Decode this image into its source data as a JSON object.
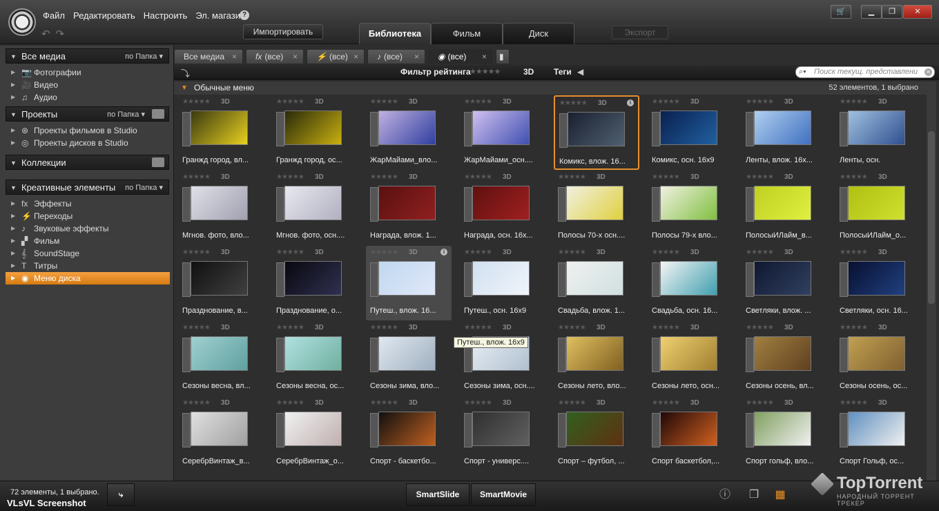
{
  "menu": [
    "Файл",
    "Редактировать",
    "Настроить",
    "Эл. магазин"
  ],
  "help_glyph": "?",
  "import_label": "Импортировать",
  "main_tabs": [
    "Библиотека",
    "Фильм",
    "Диск"
  ],
  "export_label": "Экспорт",
  "window_buttons": {
    "store": "🛒",
    "minimize": "▁",
    "maximize": "❐",
    "close": "✕"
  },
  "sidebar": {
    "all_media": {
      "title": "Все медиа",
      "option": "по Папка"
    },
    "media_items": [
      {
        "icon": "📷",
        "label": "Фотографии"
      },
      {
        "icon": "🎥",
        "label": "Видео"
      },
      {
        "icon": "♫",
        "label": "Аудио"
      }
    ],
    "projects": {
      "title": "Проекты",
      "option": "по Папка"
    },
    "project_items": [
      {
        "icon": "⊛",
        "label": "Проекты фильмов в Studio"
      },
      {
        "icon": "◎",
        "label": "Проекты дисков в Studio"
      }
    ],
    "collections": {
      "title": "Коллекции"
    },
    "creative": {
      "title": "Креативные элементы",
      "option": "по Папка"
    },
    "creative_items": [
      {
        "icon": "fx",
        "label": "Эффекты"
      },
      {
        "icon": "⚡",
        "label": "Переходы"
      },
      {
        "icon": "♪",
        "label": "Звуковые эффекты"
      },
      {
        "icon": "▞",
        "label": "Фильм"
      },
      {
        "icon": "𝄞",
        "label": "SoundStage"
      },
      {
        "icon": "T",
        "label": "Титры"
      },
      {
        "icon": "◉",
        "label": "Меню диска"
      }
    ]
  },
  "filter_tabs": [
    {
      "label": "Все медиа"
    },
    {
      "label": "(все)",
      "icon": "fx"
    },
    {
      "label": "(все)",
      "icon": "⚡"
    },
    {
      "label": "(все)",
      "icon": "♪"
    },
    {
      "label": "(все)",
      "icon": "◉"
    }
  ],
  "filterbar": {
    "rating_label": "Фильтр рейтинга",
    "stars": "★★★★★",
    "d3": "3D",
    "tags_label": "Теги",
    "search_placeholder": "Поиск текущ. представлени"
  },
  "group": {
    "title": "Обычные меню",
    "count": "52 элементов, 1 выбрано"
  },
  "stars": "★★★★★",
  "d3": "3D",
  "info_glyph": "i",
  "thumbs": [
    {
      "name": "Гранжд город, вл...",
      "colors": [
        "#3a3a10",
        "#e8d020"
      ]
    },
    {
      "name": "Гранжд город, ос...",
      "colors": [
        "#2a2a0a",
        "#c8b010"
      ]
    },
    {
      "name": "ЖарМайами_вло...",
      "colors": [
        "#c0b0e0",
        "#3040a0"
      ]
    },
    {
      "name": "ЖарМайами_осн....",
      "colors": [
        "#d0c0f0",
        "#4050b0"
      ]
    },
    {
      "name": "Комикс, влож. 16...",
      "colors": [
        "#1a2030",
        "#506070"
      ]
    },
    {
      "name": "Комикс, осн. 16x9",
      "colors": [
        "#0a2050",
        "#2060a0"
      ]
    },
    {
      "name": "Ленты, влож. 16x...",
      "colors": [
        "#b0d0f0",
        "#4070c0"
      ]
    },
    {
      "name": "Ленты, осн.",
      "colors": [
        "#a0c0e0",
        "#305090"
      ]
    },
    {
      "name": "Мгнов. фото, вло...",
      "colors": [
        "#e0e0e8",
        "#a0a0b0"
      ]
    },
    {
      "name": "Мгнов. фото, осн....",
      "colors": [
        "#e8e8f0",
        "#b0b0c0"
      ]
    },
    {
      "name": "Награда, влож. 1...",
      "colors": [
        "#5a1010",
        "#902020"
      ]
    },
    {
      "name": "Награда, осн. 16x...",
      "colors": [
        "#601010",
        "#a02020"
      ]
    },
    {
      "name": "Полосы 70-х осн....",
      "colors": [
        "#f0f0e0",
        "#e0d040"
      ]
    },
    {
      "name": "Полосы 79-х вло...",
      "colors": [
        "#f0f0e0",
        "#80c040"
      ]
    },
    {
      "name": "ПолосыИЛайм_в...",
      "colors": [
        "#c0d020",
        "#e0f040"
      ]
    },
    {
      "name": "ПолосыИЛайм_о...",
      "colors": [
        "#b0c010",
        "#d0e030"
      ]
    },
    {
      "name": "Празднование, в...",
      "colors": [
        "#101010",
        "#404040"
      ]
    },
    {
      "name": "Празднование, о...",
      "colors": [
        "#080810",
        "#303050"
      ]
    },
    {
      "name": "Путеш., влож. 16...",
      "colors": [
        "#c0d8f0",
        "#e0e8f8"
      ]
    },
    {
      "name": "Путеш., осн. 16x9",
      "colors": [
        "#d0e0f0",
        "#f0f4fa"
      ]
    },
    {
      "name": "Свадьба, влож. 1...",
      "colors": [
        "#f0f0f0",
        "#d0e0e0"
      ]
    },
    {
      "name": "Свадьба, осн. 16...",
      "colors": [
        "#f4f4f4",
        "#40a0b0"
      ]
    },
    {
      "name": "Светляки, влож. ...",
      "colors": [
        "#101830",
        "#304060"
      ]
    },
    {
      "name": "Светляки, осн. 16...",
      "colors": [
        "#081030",
        "#204080"
      ]
    },
    {
      "name": "Сезоны весна, вл...",
      "colors": [
        "#a0d0d0",
        "#60a0a0"
      ]
    },
    {
      "name": "Сезоны весна, ос...",
      "colors": [
        "#b0e0e0",
        "#70b0a0"
      ]
    },
    {
      "name": "Сезоны зима, вло...",
      "colors": [
        "#e0e8f0",
        "#a0b0c0"
      ]
    },
    {
      "name": "Сезоны зима, осн....",
      "colors": [
        "#e8eef4",
        "#b0c0d0"
      ]
    },
    {
      "name": "Сезоны лето, вло...",
      "colors": [
        "#e0c060",
        "#806020"
      ]
    },
    {
      "name": "Сезоны лето, осн...",
      "colors": [
        "#f0d070",
        "#a08030"
      ]
    },
    {
      "name": "Сезоны осень, вл...",
      "colors": [
        "#a08040",
        "#604020"
      ]
    },
    {
      "name": "Сезоны осень, ос...",
      "colors": [
        "#c0a050",
        "#806030"
      ]
    },
    {
      "name": "СеребрВинтаж_в...",
      "colors": [
        "#e0e0e0",
        "#a0a0a0"
      ]
    },
    {
      "name": "СеребрВинтаж_о...",
      "colors": [
        "#f0f0f0",
        "#c0b0b0"
      ]
    },
    {
      "name": "Спорт - баскетбо...",
      "colors": [
        "#101010",
        "#c06020"
      ]
    },
    {
      "name": "Спорт - универс....",
      "colors": [
        "#303030",
        "#606060"
      ]
    },
    {
      "name": "Спорт – футбол, ...",
      "colors": [
        "#306020",
        "#603010"
      ]
    },
    {
      "name": "Спорт баскетбол,...",
      "colors": [
        "#200808",
        "#d06020"
      ]
    },
    {
      "name": "Спорт гольф, вло...",
      "colors": [
        "#80a060",
        "#f0f0f0"
      ]
    },
    {
      "name": "Спорт Гольф, ос...",
      "colors": [
        "#6090c0",
        "#f0f0f0"
      ]
    }
  ],
  "tooltip": "Путеш., влож. 16x9",
  "bottom": {
    "status": "72 элементы, 1 выбрано.",
    "smartslide": "SmartSlide",
    "smartmovie": "SmartMovie",
    "info_glyph": "ⓘ",
    "grid_glyph": "▦"
  },
  "watermark_left": "VLsVL Screenshot",
  "brand": {
    "name": "TopTorrent",
    "tagline": "НАРОДНЫЙ ТОРРЕНТ ТРЕКЕР"
  }
}
